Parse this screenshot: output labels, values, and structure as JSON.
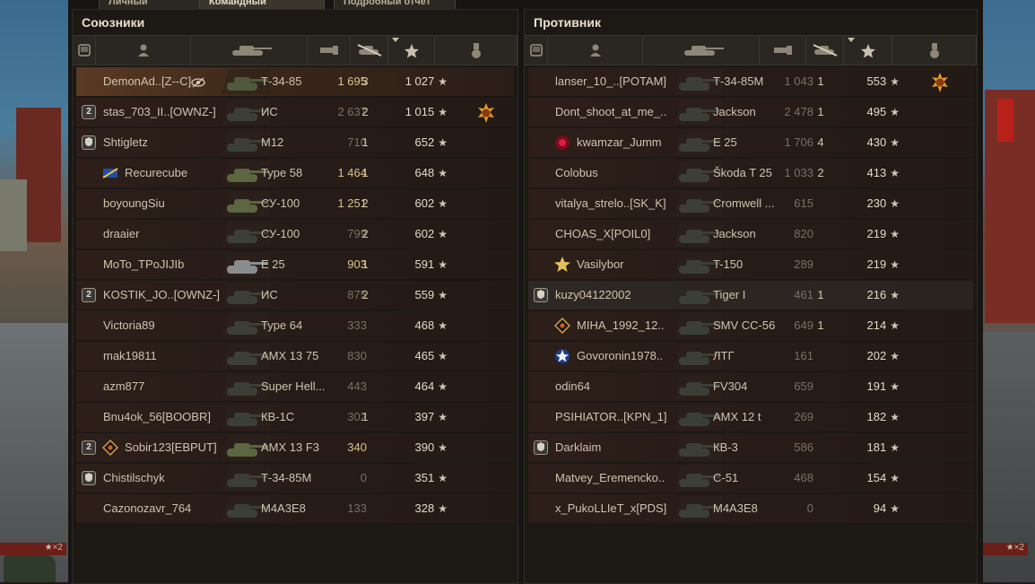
{
  "tabs": [
    "Личный результат",
    "Командный результат",
    "Подробный отчёт"
  ],
  "active_tab": 1,
  "colors": {
    "gold_damage": "#d9c48a",
    "highlight_row": "#5a3a24"
  },
  "background": {
    "left_badge": "★×2",
    "right_badge": "★×2"
  },
  "allies": {
    "title": "Союзники",
    "columns": [
      "platoon-icon",
      "player-icon",
      "vehicle-icon",
      "damage-icon",
      "frags-icon",
      "xp-star-icon",
      "medal-icon"
    ],
    "rows": [
      {
        "platoon": "",
        "emblem": "",
        "name": "DemonAd..[Z--C]",
        "vehicle": "Т-34-85",
        "damage": "1 695",
        "gold": true,
        "frags": "3",
        "xp": "1 027",
        "medal": "",
        "highlight": true,
        "tank_color": "#4f5a3c",
        "mark": "eye-icon"
      },
      {
        "platoon": "2",
        "emblem": "",
        "name": "stas_703_II..[OWNZ-]",
        "vehicle": "ИС",
        "damage": "2 637",
        "gold": false,
        "frags": "2",
        "xp": "1 015",
        "medal": "orange-medal-icon"
      },
      {
        "platoon": "shield",
        "emblem": "",
        "name": "Shtigletz",
        "vehicle": "M12",
        "damage": "710",
        "gold": false,
        "frags": "1",
        "xp": "652",
        "medal": ""
      },
      {
        "platoon": "",
        "emblem": "flag-emblem",
        "name": "Recurecube",
        "vehicle": "Type 58",
        "damage": "1 464",
        "gold": true,
        "frags": "1",
        "xp": "648",
        "medal": "",
        "tank_color": "#5c6640"
      },
      {
        "platoon": "",
        "emblem": "",
        "name": "boyoungSiu",
        "vehicle": "СУ-100",
        "damage": "1 251",
        "gold": true,
        "frags": "2",
        "xp": "602",
        "medal": "",
        "tank_color": "#5c6640"
      },
      {
        "platoon": "",
        "emblem": "",
        "name": "draaier",
        "vehicle": "СУ-100",
        "damage": "799",
        "gold": false,
        "frags": "2",
        "xp": "602",
        "medal": ""
      },
      {
        "platoon": "",
        "emblem": "",
        "name": "MoTo_TPoJIJIb",
        "vehicle": "E 25",
        "damage": "903",
        "gold": true,
        "frags": "1",
        "xp": "591",
        "medal": "",
        "tank_color": "#8b8c8e"
      },
      {
        "platoon": "2",
        "emblem": "",
        "name": "KOSTIK_JO..[OWNZ-]",
        "vehicle": "ИС",
        "damage": "875",
        "gold": false,
        "frags": "2",
        "xp": "559",
        "medal": ""
      },
      {
        "platoon": "",
        "emblem": "",
        "name": "Victoria89",
        "vehicle": "Type 64",
        "damage": "333",
        "gold": false,
        "frags": "",
        "xp": "468",
        "medal": ""
      },
      {
        "platoon": "",
        "emblem": "",
        "name": "mak19811",
        "vehicle": "AMX 13 75",
        "damage": "830",
        "gold": false,
        "frags": "",
        "xp": "465",
        "medal": ""
      },
      {
        "platoon": "",
        "emblem": "",
        "name": "azm877",
        "vehicle": "Super Hell...",
        "damage": "443",
        "gold": false,
        "frags": "",
        "xp": "464",
        "medal": ""
      },
      {
        "platoon": "",
        "emblem": "",
        "name": "Bnu4ok_56[BOOBR]",
        "vehicle": "КВ-1С",
        "damage": "302",
        "gold": false,
        "frags": "1",
        "xp": "397",
        "medal": ""
      },
      {
        "platoon": "2",
        "emblem": "diamond-emblem",
        "name": "Sobir123[EBPUT]",
        "vehicle": "AMX 13 F3",
        "damage": "340",
        "gold": true,
        "frags": "",
        "xp": "390",
        "medal": "",
        "tank_color": "#5c6640"
      },
      {
        "platoon": "shield",
        "emblem": "",
        "name": "Chistilschyk",
        "vehicle": "Т-34-85M",
        "damage": "0",
        "gold": false,
        "frags": "",
        "xp": "351",
        "medal": ""
      },
      {
        "platoon": "",
        "emblem": "",
        "name": "Cazonozavr_764",
        "vehicle": "M4A3E8",
        "damage": "133",
        "gold": false,
        "frags": "",
        "xp": "328",
        "medal": ""
      }
    ]
  },
  "enemies": {
    "title": "Противник",
    "columns": [
      "platoon-icon",
      "player-icon",
      "vehicle-icon",
      "damage-icon",
      "frags-icon",
      "xp-star-icon",
      "medal-icon"
    ],
    "rows": [
      {
        "platoon": "",
        "emblem": "",
        "name": "lanser_10_..[POTAM]",
        "vehicle": "Т-34-85M",
        "damage": "1 043",
        "gold": false,
        "frags": "1",
        "xp": "553",
        "medal": "orange-medal-icon"
      },
      {
        "platoon": "",
        "emblem": "",
        "name": "Dont_shoot_at_me_..",
        "vehicle": "Jackson",
        "damage": "2 478",
        "gold": false,
        "frags": "1",
        "xp": "495",
        "medal": ""
      },
      {
        "platoon": "",
        "emblem": "red-ring-emblem",
        "name": "kwamzar_Jumm",
        "vehicle": "E 25",
        "damage": "1 706",
        "gold": false,
        "frags": "4",
        "xp": "430",
        "medal": ""
      },
      {
        "platoon": "",
        "emblem": "",
        "name": "Colobus",
        "vehicle": "Škoda T 25",
        "damage": "1 033",
        "gold": false,
        "frags": "2",
        "xp": "413",
        "medal": ""
      },
      {
        "platoon": "",
        "emblem": "",
        "name": "vitalya_strelo..[SK_K]",
        "vehicle": "Cromwell ...",
        "damage": "615",
        "gold": false,
        "frags": "",
        "xp": "230",
        "medal": ""
      },
      {
        "platoon": "",
        "emblem": "",
        "name": "CHOAS_X[POIL0]",
        "vehicle": "Jackson",
        "damage": "820",
        "gold": false,
        "frags": "",
        "xp": "219",
        "medal": ""
      },
      {
        "platoon": "",
        "emblem": "gold-star-emblem",
        "name": "Vasilybor",
        "vehicle": "T-150",
        "damage": "289",
        "gold": false,
        "frags": "",
        "xp": "219",
        "medal": ""
      },
      {
        "platoon": "shield",
        "emblem": "",
        "name": "kuzy04122002",
        "vehicle": "Tiger I",
        "damage": "461",
        "gold": false,
        "frags": "1",
        "xp": "216",
        "medal": "",
        "hover": true
      },
      {
        "platoon": "",
        "emblem": "diamond-emblem",
        "name": "MIHA_1992_12..",
        "vehicle": "SMV CC-56",
        "damage": "649",
        "gold": false,
        "frags": "1",
        "xp": "214",
        "medal": ""
      },
      {
        "platoon": "",
        "emblem": "blue-star-emblem",
        "name": "Govoronin1978..",
        "vehicle": "ЛТГ",
        "damage": "161",
        "gold": false,
        "frags": "",
        "xp": "202",
        "medal": ""
      },
      {
        "platoon": "",
        "emblem": "",
        "name": "odin64",
        "vehicle": "FV304",
        "damage": "659",
        "gold": false,
        "frags": "",
        "xp": "191",
        "medal": ""
      },
      {
        "platoon": "",
        "emblem": "",
        "name": "PSIHIATOR..[KPN_1]",
        "vehicle": "AMX 12 t",
        "damage": "269",
        "gold": false,
        "frags": "",
        "xp": "182",
        "medal": ""
      },
      {
        "platoon": "shield",
        "emblem": "",
        "name": "Darklaim",
        "vehicle": "КВ-3",
        "damage": "586",
        "gold": false,
        "frags": "",
        "xp": "181",
        "medal": ""
      },
      {
        "platoon": "",
        "emblem": "",
        "name": "Matvey_Eremencko..",
        "vehicle": "С-51",
        "damage": "468",
        "gold": false,
        "frags": "",
        "xp": "154",
        "medal": ""
      },
      {
        "platoon": "",
        "emblem": "",
        "name": "x_PukoLLIeT_x[PDS]",
        "vehicle": "M4A3E8",
        "damage": "0",
        "gold": false,
        "frags": "",
        "xp": "94",
        "medal": ""
      }
    ]
  }
}
